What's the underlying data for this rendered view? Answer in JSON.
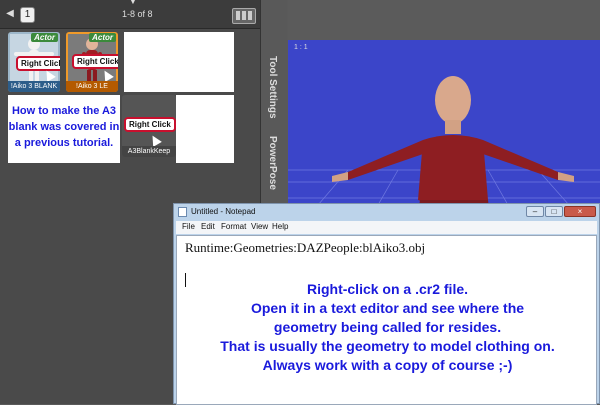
{
  "library": {
    "page_value": "1",
    "page_count": "1-8 of 8",
    "items": [
      {
        "caption": "!Aiko 3 BLANK",
        "tag": "Actor",
        "overlay": "Right Click"
      },
      {
        "caption": "!Aiko 3 LE",
        "tag": "Actor",
        "overlay": "Right Click"
      },
      {
        "caption": "A3BlankKeep",
        "overlay": "Right Click"
      }
    ],
    "note": "How to make the A3 blank was covered in a previous tutorial."
  },
  "side_tabs": {
    "tool_settings": "Tool Settings",
    "powerpose": "PowerPose"
  },
  "viewport": {
    "label": "1 : 1"
  },
  "notepad": {
    "title": "Untitled - Notepad",
    "menu": [
      "File",
      "Edit",
      "Format",
      "View",
      "Help"
    ],
    "buttons": {
      "minimize": "–",
      "maximize": "□",
      "close": "×"
    },
    "line1": "Runtime:Geometries:DAZPeople:blAiko3.obj",
    "instructions": [
      "Right-click on a .cr2 file.",
      "Open it in a text editor and see where the",
      "geometry being called for resides.",
      "That is usually the geometry to model clothing on.",
      "Always work with a copy of course ;-)"
    ]
  },
  "colors": {
    "instruction_text": "#1a1adc",
    "viewport_bg": "#3b45c9",
    "callout_border": "#c8102e"
  }
}
